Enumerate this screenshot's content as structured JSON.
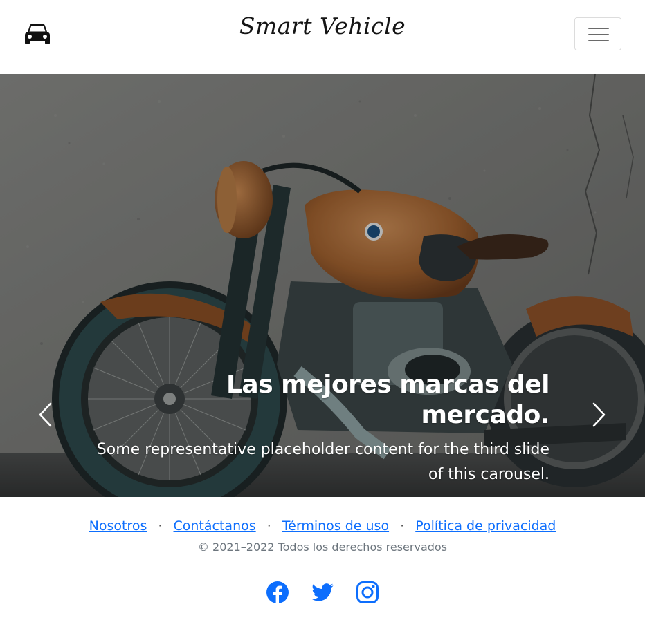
{
  "header": {
    "brand": "Smart Vehicle",
    "car_icon": "car-icon",
    "toggler_icon": "hamburger-menu-icon"
  },
  "carousel": {
    "title": "Las mejores marcas del mercado.",
    "text": "Some representative placeholder content for the third slide of this carousel.",
    "prev_icon": "chevron-left-icon",
    "next_icon": "chevron-right-icon"
  },
  "footer": {
    "links": [
      "Nosotros",
      "Contáctanos",
      "Términos de uso",
      "Política de privacidad"
    ],
    "separator": "·",
    "copyright": "© 2021–2022 Todos los derechos reservados",
    "social": [
      "facebook-icon",
      "twitter-icon",
      "instagram-icon"
    ],
    "link_color": "#0d6efd"
  }
}
